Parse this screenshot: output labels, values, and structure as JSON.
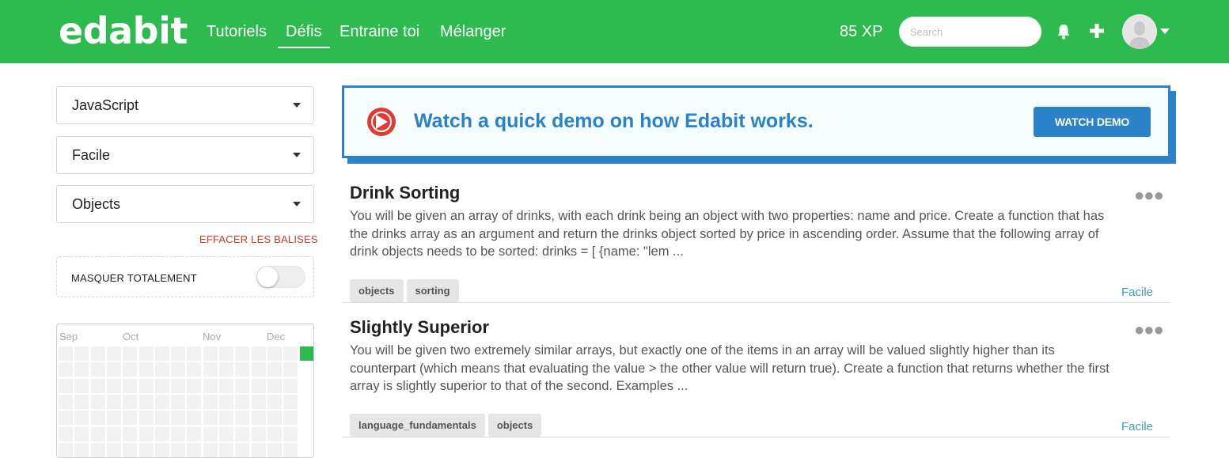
{
  "navbar": {
    "logo": "edabit",
    "links": [
      "Tutoriels",
      "Défis",
      "Entraine toi",
      "Mélanger"
    ],
    "active_link": "Défis",
    "xp": "85 XP",
    "search_placeholder": "Search",
    "icons": [
      "bell-icon",
      "plus-icon",
      "avatar",
      "chevron-down-icon"
    ]
  },
  "sidebar": {
    "language": "JavaScript",
    "difficulty": "Facile",
    "tag": "Objects",
    "clear_tags": "EFFACER LES BALISES",
    "hide_completely": "MASQUER TOTALEMENT",
    "hide_toggle_on": false,
    "heatmap_months": [
      "Sep",
      "Oct",
      "Nov",
      "Dec"
    ]
  },
  "demo": {
    "text": "Watch a quick demo on how Edabit works.",
    "button": "WATCH DEMO"
  },
  "challenges": [
    {
      "title": "Drink Sorting",
      "description": "You will be given an array of drinks, with each drink being an object with two properties: name and price. Create a function that has the drinks array as an argument and return the drinks object sorted by price in ascending order. Assume that the following array of drink objects needs to be sorted: drinks = [ {name: \"lem ...",
      "tags": [
        "objects",
        "sorting"
      ],
      "level": "Facile"
    },
    {
      "title": "Slightly Superior",
      "description": "You will be given two extremely similar arrays, but exactly one of the items in an array will be valued slightly higher than its counterpart (which means that evaluating the value > the other value will return true). Create a function that returns whether the first array is slightly superior to that of the second. Examples ...",
      "tags": [
        "language_fundamentals",
        "objects"
      ],
      "level": "Facile"
    }
  ],
  "colors": {
    "brand_green": "#2dba4e",
    "demo_blue": "#2a82c9",
    "play_red": "#e03a35",
    "clear_red": "#c73a2e",
    "level_teal": "#3a9fb8"
  }
}
